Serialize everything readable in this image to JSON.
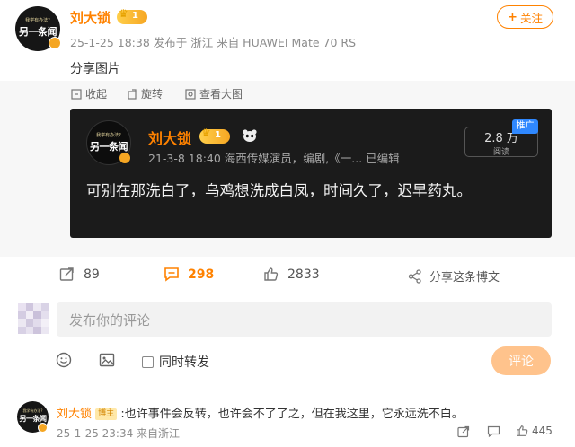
{
  "post": {
    "author_name": "刘大锁",
    "vip_level": "1",
    "follow_label": "关注",
    "meta": "25-1-25 18:38 发布于 浙江 来自 HUAWEI Mate 70 RS",
    "content": "分享图片",
    "toolbar": {
      "favorite_label": "收起",
      "rotate_label": "旋转",
      "view_large_label": "查看大图"
    }
  },
  "avatar": {
    "line1": "我学有办法?",
    "line2": "另一条闻"
  },
  "embedded_card": {
    "author_name": "刘大锁",
    "vip_level": "1",
    "meta": "21-3-8 18:40  海西传媒演员，编剧,《一...  已编辑",
    "text": "可别在那洗白了，乌鸡想洗成白凤，时间久了，迟早药丸。",
    "views_count": "2.8 万",
    "views_label": "阅读",
    "promo_tag": "推广"
  },
  "actions": {
    "repost_count": "89",
    "comment_count": "298",
    "like_count": "2833",
    "share_label": "分享这条博文"
  },
  "comment_box": {
    "placeholder": "发布你的评论",
    "sync_label": "同时转发",
    "submit_label": "评论"
  },
  "first_comment": {
    "author_name": "刘大锁",
    "author_tag": "博主",
    "text": ":也许事件会反转，也许会不了了之，但在我这里，它永远洗不白。",
    "meta": "25-1-25 23:34 来自浙江",
    "like_count": "445"
  },
  "colors": {
    "brand_orange": "#ff8200",
    "card_bg": "#1b1b1b",
    "comment_btn": "#ffc38c",
    "promo_blue": "#2f88ff"
  },
  "icons": [
    "verified-badge-icon",
    "crown-icon",
    "plus-icon",
    "favorite-icon",
    "rotate-icon",
    "view-large-icon",
    "panda-icon",
    "repost-icon",
    "comment-icon",
    "like-icon",
    "share-icon",
    "emoji-icon",
    "image-icon",
    "like-icon"
  ]
}
